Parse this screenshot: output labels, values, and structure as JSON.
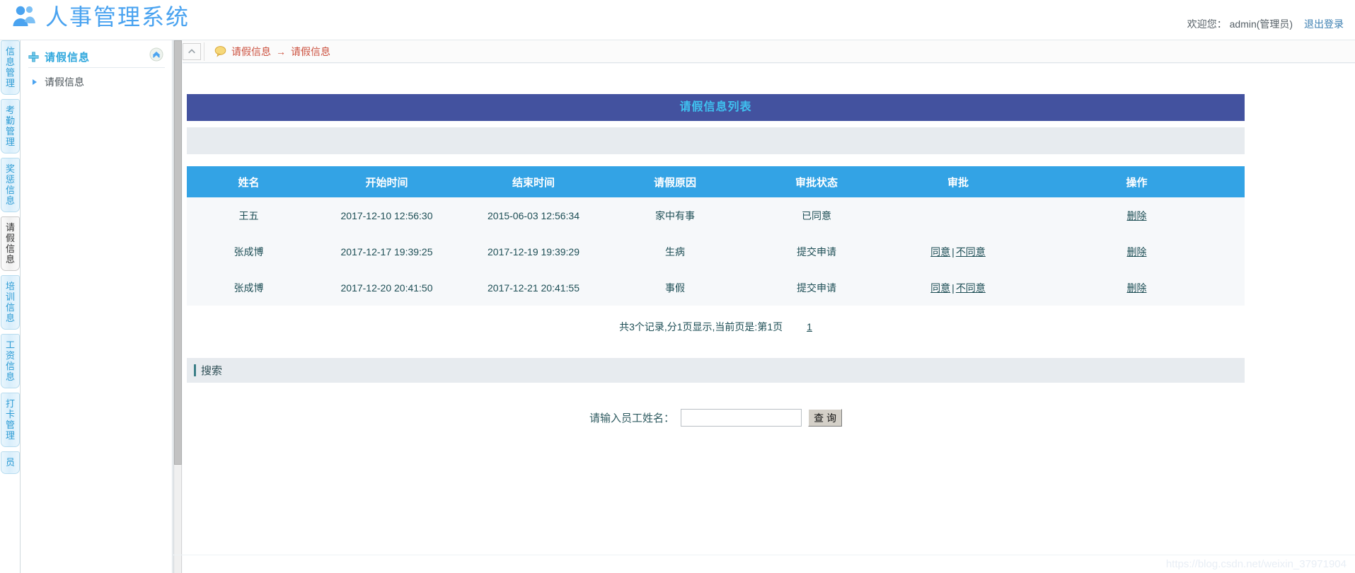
{
  "header": {
    "logo_icon": "users-group-icon",
    "title": "人事管理系统",
    "welcome_text": "欢迎您： admin(管理员)",
    "logout_label": "退出登录"
  },
  "tab_rail": {
    "items": [
      {
        "label": "信息管理",
        "active": false
      },
      {
        "label": "考勤管理",
        "active": false
      },
      {
        "label": "奖惩信息",
        "active": false
      },
      {
        "label": "请假信息",
        "active": true
      },
      {
        "label": "培训信息",
        "active": false
      },
      {
        "label": "工资信息",
        "active": false
      },
      {
        "label": "打卡管理",
        "active": false
      },
      {
        "label": "员",
        "active": false
      }
    ]
  },
  "sidebar": {
    "group_title": "请假信息",
    "plus_icon": "plus-icon",
    "collapse_icon": "chevron-up-circle-icon",
    "items": [
      {
        "label": "请假信息",
        "icon": "arrow-right-icon"
      }
    ]
  },
  "breadcrumb": {
    "bubble_icon": "speech-bubble-icon",
    "collapse_icon": "chevron-up-icon",
    "parent": "请假信息",
    "separator": "→",
    "current": "请假信息"
  },
  "panel": {
    "list_title": "请假信息列表"
  },
  "table": {
    "columns": [
      "姓名",
      "开始时间",
      "结束时间",
      "请假原因",
      "审批状态",
      "审批",
      "操作"
    ],
    "rows": [
      {
        "name": "王五",
        "start_time": "2017-12-10 12:56:30",
        "end_time": "2015-06-03 12:56:34",
        "reason": "家中有事",
        "status": "已同意",
        "approve": [],
        "operations": [
          "删除"
        ]
      },
      {
        "name": "张成博",
        "start_time": "2017-12-17 19:39:25",
        "end_time": "2017-12-19 19:39:29",
        "reason": "生病",
        "status": "提交申请",
        "approve": [
          "同意",
          "不同意"
        ],
        "operations": [
          "删除"
        ]
      },
      {
        "name": "张成博",
        "start_time": "2017-12-20 20:41:50",
        "end_time": "2017-12-21 20:41:55",
        "reason": "事假",
        "status": "提交申请",
        "approve": [
          "同意",
          "不同意"
        ],
        "operations": [
          "删除"
        ]
      }
    ],
    "approve_separator": "|"
  },
  "pager": {
    "summary": "共3个记录,分1页显示,当前页是:第1页",
    "pages": [
      "1"
    ]
  },
  "search": {
    "section_label": "搜索",
    "field_label": "请输入员工姓名：",
    "input_value": "",
    "input_placeholder": "",
    "button_label": "查 询"
  },
  "watermark": {
    "text": "https://blog.csdn.net/weixin_37971904"
  },
  "colors": {
    "brand": "#4aa3f0",
    "panel_title_bg": "#43529f",
    "panel_title_text": "#3fc1f0",
    "table_header_bg": "#33a3e5",
    "breadcrumb_text": "#cc5240"
  }
}
